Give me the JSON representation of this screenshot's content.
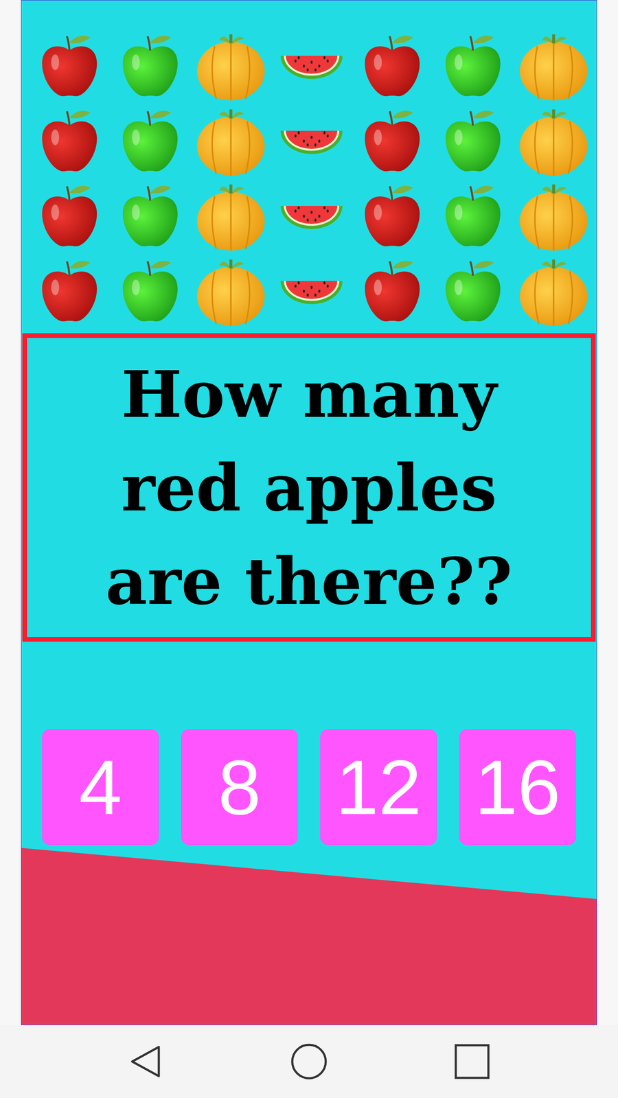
{
  "fruit_grid": {
    "rows": [
      [
        {
          "kind": "red-apple"
        },
        {
          "kind": "green-apple"
        },
        {
          "kind": "orange"
        },
        {
          "kind": "watermelon"
        },
        {
          "kind": "red-apple"
        },
        {
          "kind": "green-apple"
        },
        {
          "kind": "orange"
        }
      ],
      [
        {
          "kind": "red-apple"
        },
        {
          "kind": "green-apple"
        },
        {
          "kind": "orange"
        },
        {
          "kind": "watermelon"
        },
        {
          "kind": "red-apple"
        },
        {
          "kind": "green-apple"
        },
        {
          "kind": "orange"
        }
      ],
      [
        {
          "kind": "red-apple"
        },
        {
          "kind": "green-apple"
        },
        {
          "kind": "orange"
        },
        {
          "kind": "watermelon"
        },
        {
          "kind": "red-apple"
        },
        {
          "kind": "green-apple"
        },
        {
          "kind": "orange"
        }
      ],
      [
        {
          "kind": "red-apple"
        },
        {
          "kind": "green-apple"
        },
        {
          "kind": "orange"
        },
        {
          "kind": "watermelon"
        },
        {
          "kind": "red-apple"
        },
        {
          "kind": "green-apple"
        },
        {
          "kind": "orange"
        }
      ]
    ]
  },
  "question": {
    "lines": [
      "How many",
      "red apples",
      "are there??"
    ]
  },
  "answers": [
    "4",
    "8",
    "12",
    "16"
  ]
}
